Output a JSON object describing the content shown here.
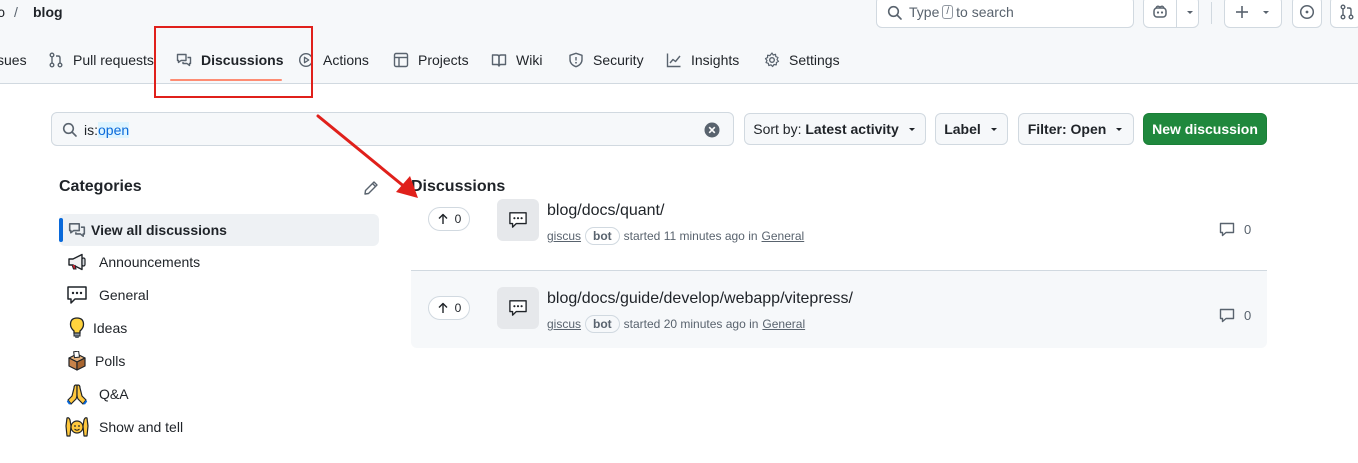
{
  "header": {
    "crumb_separator": "/",
    "repo_name": "blog",
    "search": {
      "prefix": "Type",
      "key": "/",
      "suffix": "to search"
    }
  },
  "tabs": [
    {
      "label": "sues",
      "icon": "issue-icon"
    },
    {
      "label": "Pull requests",
      "icon": "pull-request-icon"
    },
    {
      "label": "Discussions",
      "icon": "discussion-icon",
      "active": true
    },
    {
      "label": "Actions",
      "icon": "play-icon"
    },
    {
      "label": "Projects",
      "icon": "table-icon"
    },
    {
      "label": "Wiki",
      "icon": "book-icon"
    },
    {
      "label": "Security",
      "icon": "shield-icon"
    },
    {
      "label": "Insights",
      "icon": "graph-icon"
    },
    {
      "label": "Settings",
      "icon": "gear-icon"
    }
  ],
  "toolbar": {
    "query_key": "is:",
    "query_value": "open",
    "sort": {
      "prefix": "Sort by:",
      "value": "Latest activity"
    },
    "label_button": "Label",
    "filter": {
      "prefix": "Filter:",
      "value": "Open"
    },
    "new_discussion": "New discussion"
  },
  "sidebar": {
    "title": "Categories",
    "items": [
      {
        "label": "View all discussions",
        "icon": "discussion-icon",
        "active": true
      },
      {
        "label": "Announcements",
        "icon": "megaphone-icon"
      },
      {
        "label": "General",
        "icon": "speech-balloon-icon"
      },
      {
        "label": "Ideas",
        "icon": "lightbulb-icon"
      },
      {
        "label": "Polls",
        "icon": "ballot-box-icon"
      },
      {
        "label": "Q&A",
        "icon": "praying-hands-icon"
      },
      {
        "label": "Show and tell",
        "icon": "raising-hands-icon"
      }
    ]
  },
  "discussions": {
    "title": "Discussions",
    "items": [
      {
        "title": "blog/docs/quant/",
        "author": "giscus",
        "badge": "bot",
        "started": "started 11 minutes ago in",
        "category": "General",
        "votes": "0",
        "comments": "0"
      },
      {
        "title": "blog/docs/guide/develop/webapp/vitepress/",
        "author": "giscus",
        "badge": "bot",
        "started": "started 20 minutes ago in",
        "category": "General",
        "votes": "0",
        "comments": "0"
      }
    ]
  },
  "colors": {
    "accent_blue": "#0969da",
    "primary_green": "#1f883d",
    "tab_underline": "#fd8c73",
    "annotation_red": "#e0201b"
  }
}
